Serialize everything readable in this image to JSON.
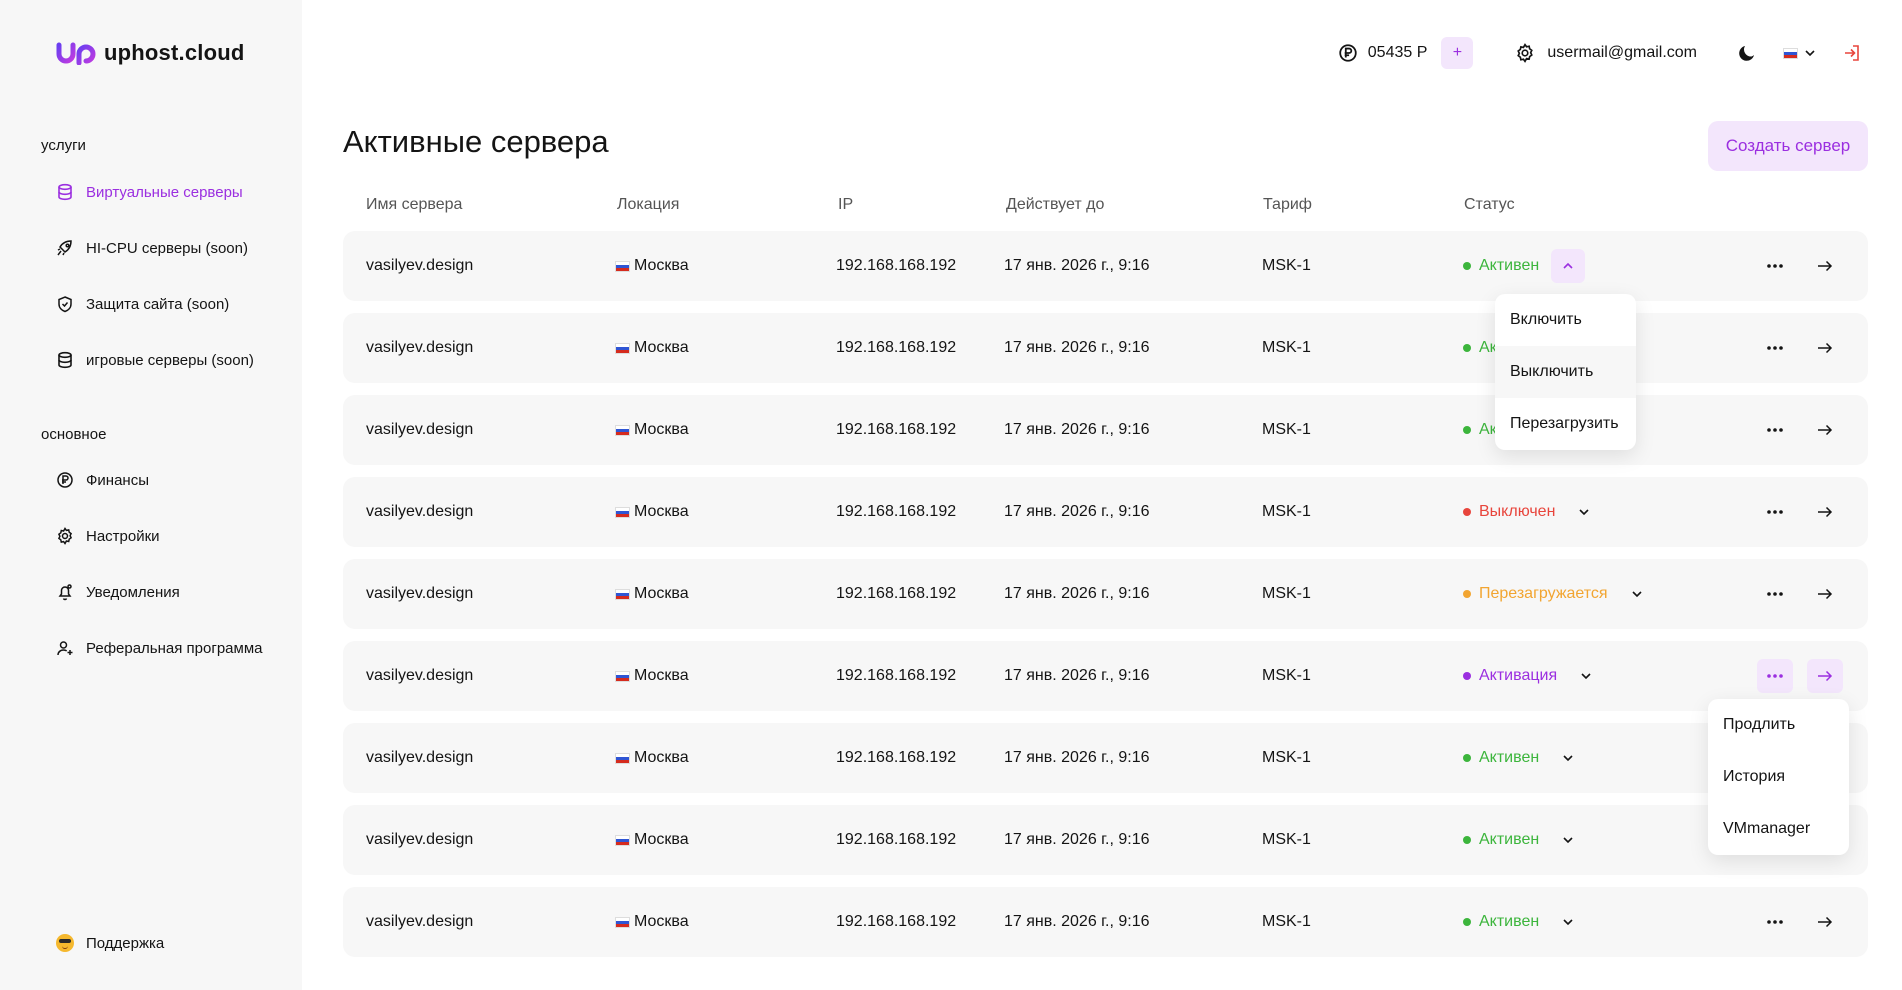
{
  "brand": {
    "name": "uphost.cloud",
    "accent": "#9b2fe0",
    "accent_bg": "#f3e6fc"
  },
  "sidebar": {
    "sections": [
      {
        "title": "услуги",
        "items": [
          {
            "label": "Виртуальные серверы",
            "icon": "database-icon",
            "active": true
          },
          {
            "label": "HI-CPU серверы (soon)",
            "icon": "rocket-icon"
          },
          {
            "label": "Защита сайта (soon)",
            "icon": "shield-icon"
          },
          {
            "label": "игровые серверы (soon)",
            "icon": "database-icon"
          }
        ]
      },
      {
        "title": "основное",
        "items": [
          {
            "label": "Финансы",
            "icon": "ruble-icon"
          },
          {
            "label": "Настройки",
            "icon": "gear-icon"
          },
          {
            "label": "Уведомления",
            "icon": "bell-icon"
          },
          {
            "label": "Реферальная программа",
            "icon": "user-plus-icon"
          }
        ]
      }
    ],
    "support_label": "Поддержка"
  },
  "header": {
    "balance": "05435 Р",
    "add_funds": "+",
    "email": "usermail@gmail.com"
  },
  "page": {
    "title": "Активные сервера",
    "create_button": "Создать сервер"
  },
  "table": {
    "columns": [
      "Имя сервера",
      "Локация",
      "IP",
      "Действует до",
      "Тариф",
      "Статус"
    ],
    "rows": [
      {
        "name": "vasilyev.design",
        "location": "Москва",
        "ip": "192.168.168.192",
        "until": "17 янв. 2026 г., 9:16",
        "tariff": "MSK-1",
        "status": "Активен",
        "status_color": "#3cb53c",
        "status_open": true
      },
      {
        "name": "vasilyev.design",
        "location": "Москва",
        "ip": "192.168.168.192",
        "until": "17 янв. 2026 г., 9:16",
        "tariff": "MSK-1",
        "status": "Ак",
        "status_color": "#3cb53c"
      },
      {
        "name": "vasilyev.design",
        "location": "Москва",
        "ip": "192.168.168.192",
        "until": "17 янв. 2026 г., 9:16",
        "tariff": "MSK-1",
        "status": "Ак",
        "status_color": "#3cb53c"
      },
      {
        "name": "vasilyev.design",
        "location": "Москва",
        "ip": "192.168.168.192",
        "until": "17 янв. 2026 г., 9:16",
        "tariff": "MSK-1",
        "status": "Выключен",
        "status_color": "#e8453c"
      },
      {
        "name": "vasilyev.design",
        "location": "Москва",
        "ip": "192.168.168.192",
        "until": "17 янв. 2026 г., 9:16",
        "tariff": "MSK-1",
        "status": "Перезагружается",
        "status_color": "#f2a531"
      },
      {
        "name": "vasilyev.design",
        "location": "Москва",
        "ip": "192.168.168.192",
        "until": "17 янв. 2026 г., 9:16",
        "tariff": "MSK-1",
        "status": "Активация",
        "status_color": "#9b2fe0",
        "actions_open": true
      },
      {
        "name": "vasilyev.design",
        "location": "Москва",
        "ip": "192.168.168.192",
        "until": "17 янв. 2026 г., 9:16",
        "tariff": "MSK-1",
        "status": "Активен",
        "status_color": "#3cb53c"
      },
      {
        "name": "vasilyev.design",
        "location": "Москва",
        "ip": "192.168.168.192",
        "until": "17 янв. 2026 г., 9:16",
        "tariff": "MSK-1",
        "status": "Активен",
        "status_color": "#3cb53c"
      },
      {
        "name": "vasilyev.design",
        "location": "Москва",
        "ip": "192.168.168.192",
        "until": "17 янв. 2026 г., 9:16",
        "tariff": "MSK-1",
        "status": "Активен",
        "status_color": "#3cb53c"
      }
    ]
  },
  "status_menu": {
    "items": [
      "Включить",
      "Выключить",
      "Перезагрузить"
    ],
    "hovered": "Выключить"
  },
  "actions_menu": {
    "items": [
      "Продлить",
      "История",
      "VMmanager"
    ]
  }
}
